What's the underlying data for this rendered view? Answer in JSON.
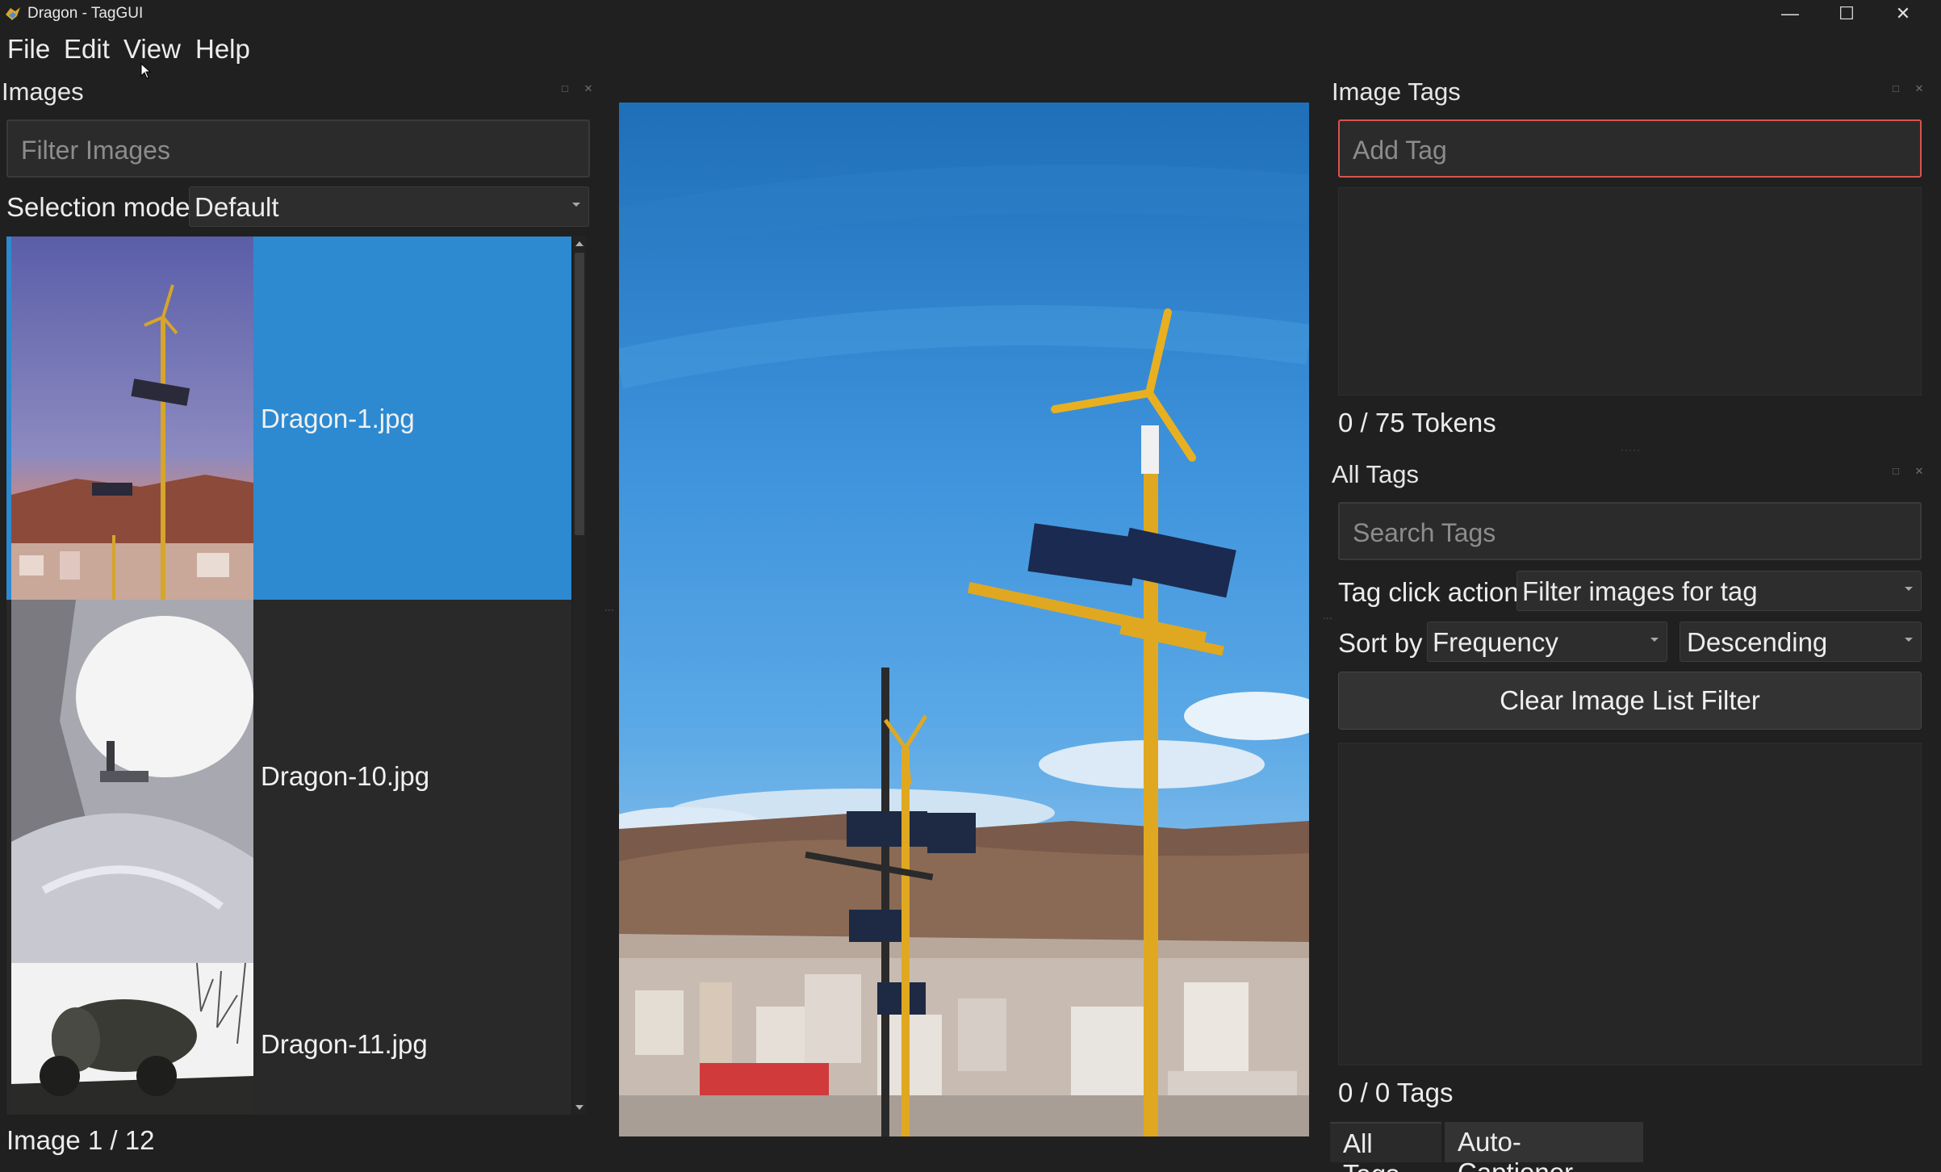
{
  "window": {
    "title": "Dragon - TagGUI",
    "minimize": "—",
    "maximize": "☐",
    "close": "✕"
  },
  "menu": [
    "File",
    "Edit",
    "View",
    "Help"
  ],
  "images_dock": {
    "title": "Images",
    "filter_placeholder": "Filter Images",
    "selection_mode_label": "Selection mode",
    "selection_mode_value": "Default",
    "items": [
      {
        "name": "Dragon-1.jpg",
        "selected": true
      },
      {
        "name": "Dragon-10.jpg",
        "selected": false
      },
      {
        "name": "Dragon-11.jpg",
        "selected": false
      }
    ],
    "status": "Image 1 / 12"
  },
  "image_tags_dock": {
    "title": "Image Tags",
    "add_tag_placeholder": "Add Tag",
    "tokens": "0 / 75 Tokens"
  },
  "all_tags_dock": {
    "title": "All Tags",
    "search_placeholder": "Search Tags",
    "tag_click_action_label": "Tag click action",
    "tag_click_action_value": "Filter images for tag",
    "sort_by_label": "Sort by",
    "sort_by_value": "Frequency",
    "sort_order_value": "Descending",
    "clear_button": "Clear Image List Filter",
    "tag_count": "0 / 0 Tags"
  },
  "bottom_tabs": [
    "All Tags",
    "Auto-Captioner"
  ],
  "colors": {
    "selection": "#2d8ad1",
    "focus_border": "#d9534f",
    "background": "#202020"
  }
}
